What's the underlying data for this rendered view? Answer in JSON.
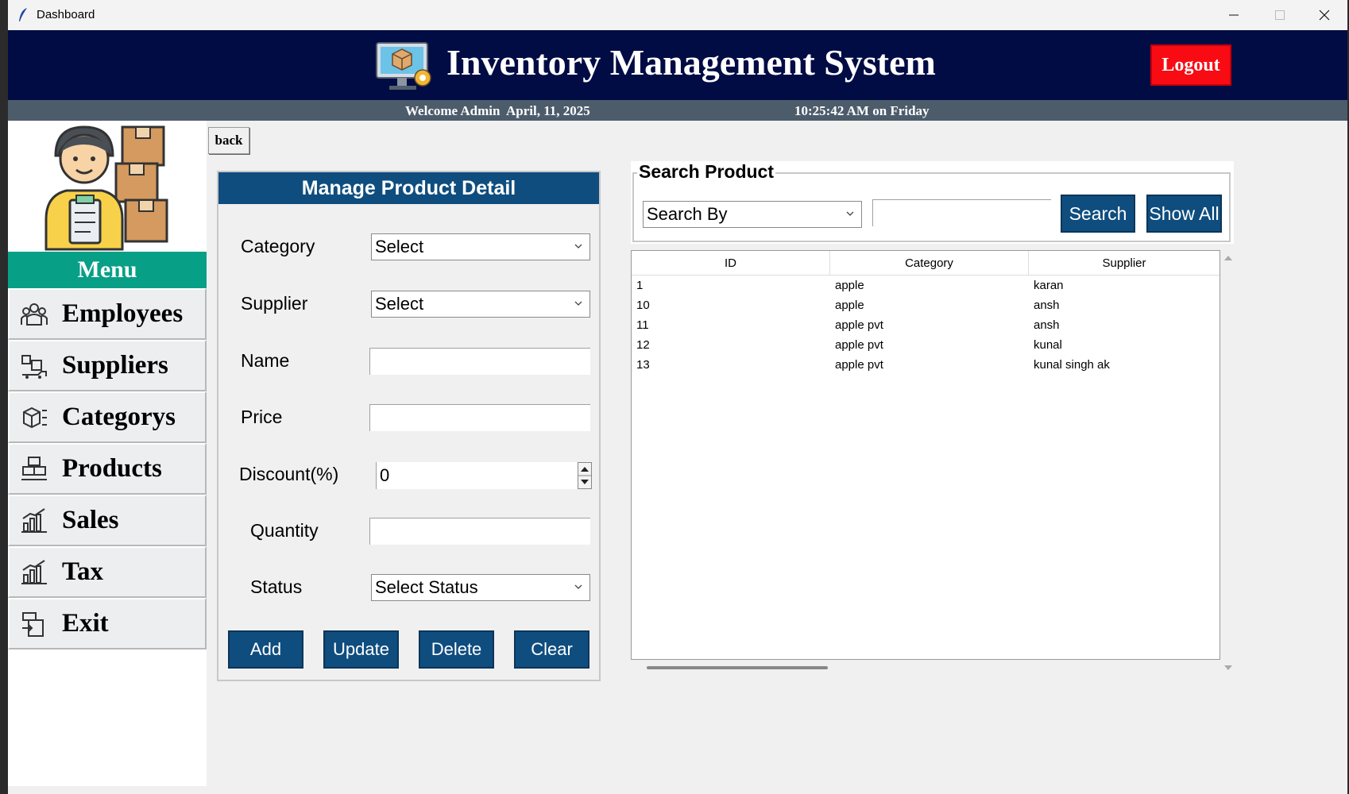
{
  "window": {
    "title": "Dashboard"
  },
  "header": {
    "title": "Inventory Management System",
    "logout_label": "Logout"
  },
  "subheader": {
    "welcome": "Welcome Admin  April, 11, 2025",
    "clock": "10:25:42 AM on Friday"
  },
  "sidebar": {
    "menu_title": "Menu",
    "items": [
      {
        "label": "Employees",
        "icon": "employees-icon"
      },
      {
        "label": "Suppliers",
        "icon": "suppliers-icon"
      },
      {
        "label": "Categorys",
        "icon": "categories-icon"
      },
      {
        "label": "Products",
        "icon": "products-icon"
      },
      {
        "label": "Sales",
        "icon": "sales-icon"
      },
      {
        "label": "Tax",
        "icon": "tax-icon"
      },
      {
        "label": "Exit",
        "icon": "exit-icon"
      }
    ]
  },
  "back_label": "back",
  "form": {
    "title": "Manage Product Detail",
    "category_label": "Category",
    "category_value": "Select",
    "supplier_label": "Supplier",
    "supplier_value": "Select",
    "name_label": "Name",
    "name_value": "",
    "price_label": "Price",
    "price_value": "",
    "discount_label": "Discount(%)",
    "discount_value": "0",
    "quantity_label": "Quantity",
    "quantity_value": "",
    "status_label": "Status",
    "status_value": "Select Status",
    "buttons": {
      "add": "Add",
      "update": "Update",
      "delete": "Delete",
      "clear": "Clear"
    }
  },
  "search": {
    "title": "Search Product",
    "search_by": "Search By",
    "query": "",
    "search_label": "Search",
    "show_all_label": "Show All"
  },
  "table": {
    "columns": [
      "ID",
      "Category",
      "Supplier"
    ],
    "rows": [
      [
        "1",
        "apple",
        "karan"
      ],
      [
        "10",
        "apple",
        "ansh"
      ],
      [
        "11",
        "apple pvt",
        "ansh"
      ],
      [
        "12",
        "apple pvt",
        "kunal"
      ],
      [
        "13",
        "apple pvt",
        "kunal singh ak"
      ]
    ]
  },
  "colors": {
    "header_bg": "#010c44",
    "subbar_bg": "#4c5c6b",
    "menu_title_bg": "#089f87",
    "logout_bg": "#f90b14",
    "button_bg": "#0f4d7f"
  }
}
